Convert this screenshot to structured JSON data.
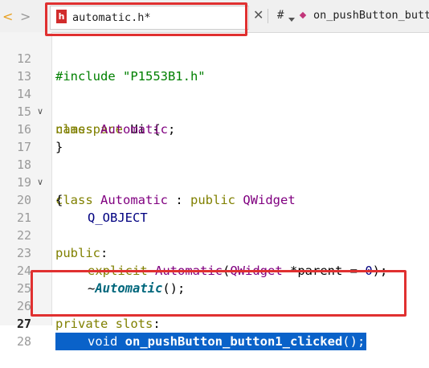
{
  "tab": {
    "back_icon": "chevron-left-icon",
    "forward_icon": "chevron-right-icon",
    "file_icon_letter": "h",
    "file_name": "automatic.h*",
    "close_glyph": "✕",
    "hash": "#",
    "function_name": "on_pushButton_butt"
  },
  "lines": [
    {
      "num": "12",
      "text": "#include \"P1553B1.h\""
    },
    {
      "num": "13",
      "text": ""
    },
    {
      "num": "14",
      "fold": "∨",
      "kw": "namespace",
      "rest": " Ui {"
    },
    {
      "num": "15",
      "kw": "class",
      "type": "Automatic",
      "rest": ";"
    },
    {
      "num": "16",
      "text": "}"
    },
    {
      "num": "17",
      "text": ""
    },
    {
      "num": "18",
      "fold": "∨",
      "kw": "class",
      "type": "Automatic",
      "mid": " : ",
      "kw2": "public",
      "type2": "QWidget"
    },
    {
      "num": "19",
      "text": "{"
    },
    {
      "num": "20",
      "macro": "Q_OBJECT"
    },
    {
      "num": "21",
      "text": ""
    },
    {
      "num": "22",
      "kw": "public",
      "rest": ":"
    },
    {
      "num": "23",
      "kw": "explicit",
      "type": "Automatic",
      "rest_a": "(",
      "type2": "QWidget",
      "rest_b": " *parent = ",
      "num_val": "0",
      "rest_c": ");"
    },
    {
      "num": "24",
      "prefix": "~",
      "ital": "Automatic",
      "rest": "();"
    },
    {
      "num": "25",
      "text": ""
    },
    {
      "num": "26",
      "kw": "private slots",
      "rest": ":"
    },
    {
      "num": "27",
      "kw": "void",
      "fn": "on_pushButton_button1_clicked",
      "rest": "();"
    },
    {
      "num": "28",
      "text": ""
    }
  ],
  "colors": {
    "keyword": "#808000",
    "type": "#800080",
    "selection": "#0a62c9",
    "highlight_box": "#e03030"
  }
}
